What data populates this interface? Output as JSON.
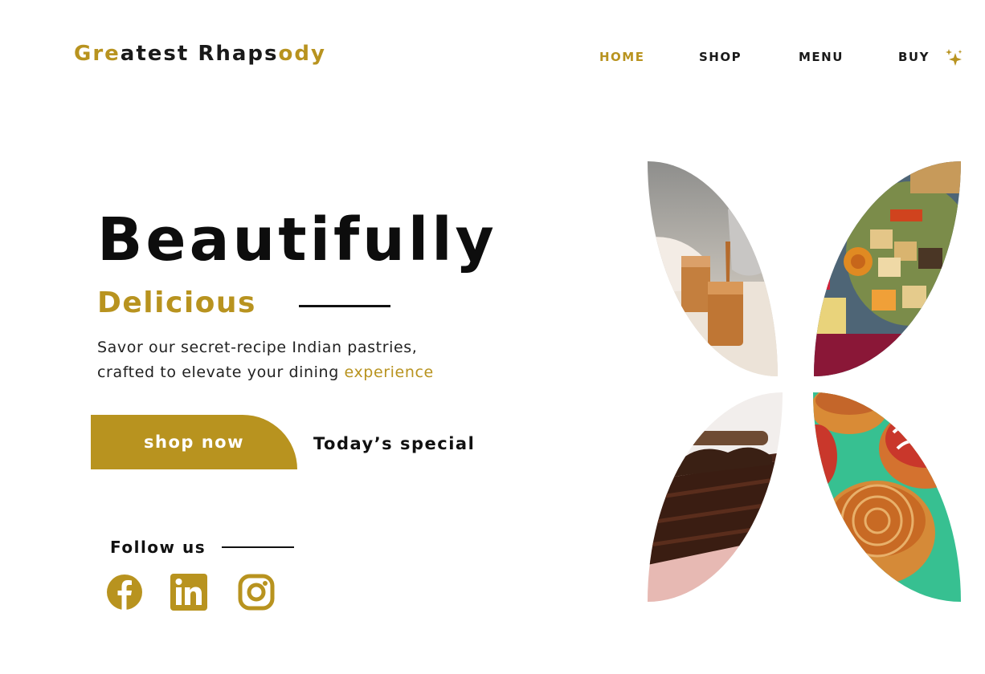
{
  "header": {
    "logo_parts": [
      "Gre",
      "atest Rhaps",
      "ody"
    ],
    "nav": [
      "HOME",
      "SHOP",
      "MENU",
      "BUY"
    ],
    "active_nav": "HOME"
  },
  "hero": {
    "title": "Beautifully",
    "subtitle": "Delicious",
    "description_line1": "Savor our secret-recipe Indian pastries,",
    "description_line2": "crafted to elevate your dining ",
    "description_highlight": "experience",
    "shop_button": "shop now",
    "special_link": "Today’s special"
  },
  "social": {
    "label": "Follow us",
    "icons": [
      "facebook-icon",
      "linkedin-icon",
      "instagram-icon"
    ]
  },
  "gallery": {
    "images": [
      "masala-chai-image",
      "indian-sweets-image",
      "chocolate-cake-image",
      "glazed-buns-image"
    ]
  },
  "colors": {
    "accent": "#b8931f",
    "text": "#111111",
    "background": "#ffffff"
  }
}
